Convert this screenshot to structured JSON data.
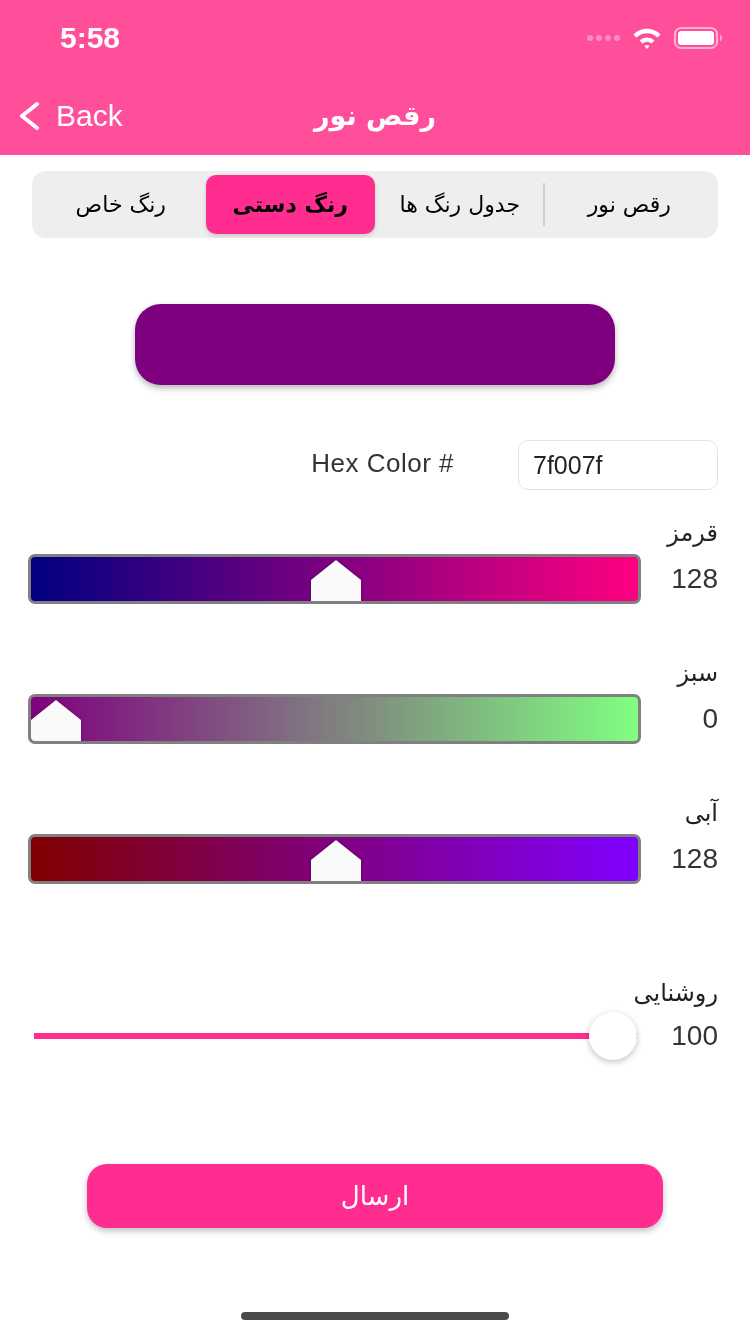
{
  "status_bar": {
    "time": "5:58"
  },
  "nav_bar": {
    "back_label": "Back",
    "title": "رقص نور"
  },
  "tabs": [
    {
      "label": "رقص نور",
      "selected": false
    },
    {
      "label": "جدول رنگ ها",
      "selected": false
    },
    {
      "label": "رنگ دستی",
      "selected": true
    },
    {
      "label": "رنگ خاص",
      "selected": false
    }
  ],
  "hex_field": {
    "label": "Hex Color #",
    "value": "7f007f"
  },
  "channels": [
    {
      "label": "قرمز",
      "value": "128",
      "level": 0.502
    },
    {
      "label": "سبز",
      "value": "0",
      "level": 0
    },
    {
      "label": "آبی",
      "value": "128",
      "level": 0.502
    }
  ],
  "brightness": {
    "label": "روشنایی",
    "value": "100",
    "level": 1
  },
  "submit_button": {
    "label": "ارسال"
  }
}
